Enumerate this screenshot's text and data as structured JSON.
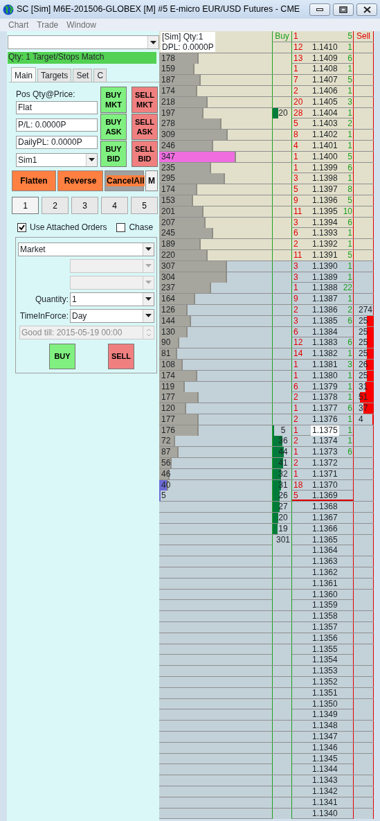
{
  "window": {
    "title": "SC [Sim] M6E-201506-GLOBEX [M]  #5  E-micro EUR/USD Futures - CME"
  },
  "menu": [
    {
      "label": "Chart"
    },
    {
      "label": "Trade"
    },
    {
      "label": "Window"
    }
  ],
  "status": "Qty: 1 Target/Stops Match",
  "tabs": [
    {
      "label": "Main",
      "selected": true
    },
    {
      "label": "Targets",
      "selected": false
    },
    {
      "label": "Set",
      "selected": false
    },
    {
      "label": "C",
      "selected": false
    }
  ],
  "position": {
    "label": "Pos Qty@Price:",
    "fields": [
      "Flat",
      "P/L: 0.0000P",
      "DailyPL: 0.0000P"
    ],
    "account": "Sim1"
  },
  "quick_buttons": [
    {
      "label": "BUY\nMKT",
      "kind": "buy"
    },
    {
      "label": "SELL\nMKT",
      "kind": "sell"
    },
    {
      "label": "BUY\nASK",
      "kind": "buy"
    },
    {
      "label": "SELL\nASK",
      "kind": "sell"
    },
    {
      "label": "BUY\nBID",
      "kind": "buy"
    },
    {
      "label": "SELL\nBID",
      "kind": "sell"
    }
  ],
  "action_buttons": [
    {
      "label": "Flatten",
      "kind": "orange"
    },
    {
      "label": "Reverse",
      "kind": "orange"
    },
    {
      "label": "CancelAll",
      "kind": "cancel"
    },
    {
      "label": "M",
      "kind": "plain"
    }
  ],
  "qty_presets": [
    {
      "label": "1",
      "selected": true
    },
    {
      "label": "2",
      "selected": false
    },
    {
      "label": "3",
      "selected": false
    },
    {
      "label": "4",
      "selected": false
    },
    {
      "label": "5",
      "selected": false
    }
  ],
  "options": [
    {
      "label": "Use Attached Orders",
      "checked": true
    },
    {
      "label": "Chase",
      "checked": false
    }
  ],
  "order_entry": {
    "order_type": "Market",
    "quantity_label": "Quantity:",
    "quantity": "1",
    "tif_label": "TimeInForce:",
    "tif": "Day",
    "good_till": "Good till: 2015-05-19 00:00",
    "buy": "BUY",
    "sell": "SELL"
  },
  "dom": {
    "header": {
      "account": "[Sim]  Qty:1",
      "dpl": "DPL: 0.0000P",
      "buy_title": "Buy",
      "sell_title": "Sell"
    },
    "rows": [
      {
        "column_3": "1",
        "column_5": "5",
        "kind": "upper",
        "last": false
      },
      {
        "price": "1.1410",
        "column_3": "12",
        "column_5": "1",
        "kind": "upper",
        "last": false
      },
      {
        "price": "1.1409",
        "volume": "178",
        "volume_bar": {
          "level": 0.35,
          "color": "#a7a69e"
        },
        "column_3": "13",
        "column_5": "6",
        "kind": "upper",
        "last": false
      },
      {
        "price": "1.1408",
        "volume": "159",
        "volume_bar": {
          "level": 0.31,
          "color": "#a7a69e"
        },
        "column_3": "1",
        "column_5": "1",
        "kind": "upper",
        "last": false
      },
      {
        "price": "1.1407",
        "volume": "187",
        "volume_bar": {
          "level": 0.37,
          "color": "#a7a69e"
        },
        "column_3": "7",
        "column_5": "5",
        "kind": "upper",
        "last": false
      },
      {
        "price": "1.1406",
        "volume": "174",
        "volume_bar": {
          "level": 0.34,
          "color": "#a7a69e"
        },
        "column_3": "2",
        "column_5": "1",
        "kind": "upper",
        "last": false
      },
      {
        "price": "1.1405",
        "volume": "218",
        "volume_bar": {
          "level": 0.43,
          "color": "#a7a69e"
        },
        "column_3": "20",
        "column_5": "3",
        "kind": "upper",
        "last": false
      },
      {
        "price": "1.1404",
        "volume": "197",
        "volume_bar": {
          "level": 0.39,
          "color": "#a7a69e"
        },
        "buy": "20",
        "buy_bar": {
          "level": 0.28
        },
        "column_3": "28",
        "column_5": "1",
        "kind": "upper",
        "last": false
      },
      {
        "price": "1.1403",
        "volume": "278",
        "volume_bar": {
          "level": 0.55,
          "color": "#a7a69e"
        },
        "column_3": "5",
        "column_5": "2",
        "kind": "upper",
        "last": false
      },
      {
        "price": "1.1402",
        "volume": "309",
        "volume_bar": {
          "level": 0.61,
          "color": "#a7a69e"
        },
        "column_3": "8",
        "column_5": "1",
        "kind": "upper",
        "last": false
      },
      {
        "price": "1.1401",
        "volume": "246",
        "volume_bar": {
          "level": 0.48,
          "color": "#a7a69e"
        },
        "column_3": "4",
        "column_5": "1",
        "kind": "upper",
        "last": false
      },
      {
        "price": "1.1400",
        "volume": "347",
        "volume_bar": {
          "level": 0.68,
          "color": "#ee6ee0"
        },
        "column_3": "1",
        "column_5": "5",
        "kind": "upper",
        "last": false
      },
      {
        "price": "1.1399",
        "volume": "235",
        "volume_bar": {
          "level": 0.46,
          "color": "#a7a69e"
        },
        "column_3": "1",
        "column_5": "6",
        "kind": "upper",
        "last": false
      },
      {
        "price": "1.1398",
        "volume": "295",
        "volume_bar": {
          "level": 0.58,
          "color": "#a7a69e"
        },
        "column_3": "3",
        "column_5": "1",
        "kind": "upper",
        "last": false
      },
      {
        "price": "1.1397",
        "volume": "174",
        "volume_bar": {
          "level": 0.34,
          "color": "#a7a69e"
        },
        "column_3": "5",
        "column_5": "8",
        "kind": "upper",
        "last": false
      },
      {
        "price": "1.1396",
        "volume": "153",
        "volume_bar": {
          "level": 0.3,
          "color": "#a7a69e"
        },
        "column_3": "9",
        "column_5": "5",
        "kind": "upper",
        "last": false
      },
      {
        "price": "1.1395",
        "volume": "201",
        "volume_bar": {
          "level": 0.39,
          "color": "#a7a69e"
        },
        "column_3": "11",
        "column_5": "10",
        "kind": "upper",
        "last": false
      },
      {
        "price": "1.1394",
        "volume": "207",
        "volume_bar": {
          "level": 0.41,
          "color": "#a7a69e"
        },
        "column_3": "3",
        "column_5": "6",
        "kind": "upper",
        "last": false
      },
      {
        "price": "1.1393",
        "volume": "245",
        "volume_bar": {
          "level": 0.48,
          "color": "#a7a69e"
        },
        "column_3": "6",
        "column_5": "1",
        "kind": "upper",
        "last": false
      },
      {
        "price": "1.1392",
        "volume": "189",
        "volume_bar": {
          "level": 0.37,
          "color": "#a7a69e"
        },
        "column_3": "2",
        "column_5": "1",
        "kind": "upper",
        "last": false
      },
      {
        "price": "1.1391",
        "volume": "220",
        "volume_bar": {
          "level": 0.43,
          "color": "#a7a69e"
        },
        "column_3": "11",
        "column_5": "5",
        "kind": "upper",
        "last": false
      },
      {
        "price": "1.1390",
        "volume": "307",
        "volume_bar": {
          "level": 0.6,
          "color": "#a7a69e"
        },
        "column_3": "3",
        "column_5": "1",
        "kind": "lower",
        "last": false
      },
      {
        "price": "1.1389",
        "volume": "304",
        "volume_bar": {
          "level": 0.6,
          "color": "#a7a69e"
        },
        "column_3": "3",
        "column_5": "1",
        "kind": "lower",
        "last": false
      },
      {
        "price": "1.1388",
        "volume": "237",
        "volume_bar": {
          "level": 0.46,
          "color": "#a7a69e"
        },
        "column_3": "1",
        "column_5": "22",
        "kind": "lower",
        "last": false
      },
      {
        "price": "1.1387",
        "volume": "164",
        "volume_bar": {
          "level": 0.32,
          "color": "#a7a69e"
        },
        "column_3": "9",
        "column_5": "1",
        "kind": "lower",
        "last": false
      },
      {
        "price": "1.1386",
        "volume": "126",
        "volume_bar": {
          "level": 0.25,
          "color": "#a7a69e"
        },
        "column_3": "2",
        "column_5": "2",
        "sell": "274",
        "kind": "lower",
        "last": false
      },
      {
        "price": "1.1385",
        "volume": "144",
        "volume_bar": {
          "level": 0.28,
          "color": "#a7a69e"
        },
        "column_3": "3",
        "column_5": "6",
        "sell": "25",
        "sell_bar": {
          "level": 0.33
        },
        "kind": "lower",
        "last": false
      },
      {
        "price": "1.1384",
        "volume": "130",
        "volume_bar": {
          "level": 0.25,
          "color": "#a7a69e"
        },
        "column_3": "6",
        "sell": "25",
        "sell_bar": {
          "level": 0.33
        },
        "kind": "lower",
        "last": false
      },
      {
        "price": "1.1383",
        "volume": "90",
        "volume_bar": {
          "level": 0.18,
          "color": "#a7a69e"
        },
        "column_3": "12",
        "column_5": "6",
        "sell": "25",
        "sell_bar": {
          "level": 0.33
        },
        "kind": "lower",
        "last": false
      },
      {
        "price": "1.1382",
        "volume": "81",
        "volume_bar": {
          "level": 0.16,
          "color": "#a7a69e"
        },
        "column_3": "14",
        "column_5": "1",
        "sell": "25",
        "sell_bar": {
          "level": 0.33
        },
        "kind": "lower",
        "last": false
      },
      {
        "price": "1.1381",
        "volume": "108",
        "volume_bar": {
          "level": 0.21,
          "color": "#a7a69e"
        },
        "column_3": "1",
        "column_5": "3",
        "sell": "26",
        "sell_bar": {
          "level": 0.37
        },
        "kind": "lower",
        "last": false
      },
      {
        "price": "1.1380",
        "volume": "174",
        "volume_bar": {
          "level": 0.34,
          "color": "#a7a69e"
        },
        "column_3": "1",
        "column_5": "1",
        "sell": "25",
        "sell_bar": {
          "level": 0.33
        },
        "kind": "lower",
        "last": false
      },
      {
        "price": "1.1379",
        "volume": "119",
        "volume_bar": {
          "level": 0.23,
          "color": "#a7a69e"
        },
        "column_3": "6",
        "column_5": "1",
        "sell": "31",
        "sell_bar": {
          "level": 0.4
        },
        "kind": "lower",
        "last": false
      },
      {
        "price": "1.1378",
        "volume": "177",
        "volume_bar": {
          "level": 0.35,
          "color": "#a7a69e"
        },
        "column_3": "2",
        "column_5": "1",
        "sell": "51",
        "sell_bar": {
          "level": 0.67
        },
        "kind": "lower",
        "last": false
      },
      {
        "price": "1.1377",
        "volume": "120",
        "volume_bar": {
          "level": 0.24,
          "color": "#a7a69e"
        },
        "column_3": "1",
        "column_5": "6",
        "sell": "37",
        "sell_bar": {
          "level": 0.5
        },
        "kind": "lower",
        "last": false
      },
      {
        "price": "1.1376",
        "volume": "177",
        "volume_bar": {
          "level": 0.35,
          "color": "#a7a69e"
        },
        "column_3": "2",
        "column_5": "1",
        "sell": "4",
        "sell_bar": {
          "level": 0.05
        },
        "kind": "lower",
        "last": false
      },
      {
        "price": "1.1375",
        "volume": "176",
        "volume_bar": {
          "level": 0.35,
          "color": "#a7a69e"
        },
        "buy": "5",
        "buy_bar": {
          "level": 0.07
        },
        "column_3": "1",
        "column_5": "1",
        "kind": "lower",
        "last": true
      },
      {
        "price": "1.1374",
        "volume": "72",
        "volume_bar": {
          "level": 0.14,
          "color": "#a7a69e"
        },
        "buy": "36",
        "buy_bar": {
          "level": 0.5
        },
        "column_3": "2",
        "column_5": "1",
        "kind": "lower",
        "last": false
      },
      {
        "price": "1.1373",
        "volume": "87",
        "volume_bar": {
          "level": 0.17,
          "color": "#a7a69e"
        },
        "buy": "44",
        "buy_bar": {
          "level": 0.61
        },
        "column_3": "1",
        "column_5": "6",
        "kind": "lower",
        "last": false
      },
      {
        "price": "1.1372",
        "volume": "56",
        "volume_bar": {
          "level": 0.11,
          "color": "#a7a69e"
        },
        "buy": "41",
        "buy_bar": {
          "level": 0.57
        },
        "column_3": "2",
        "kind": "lower",
        "last": false
      },
      {
        "price": "1.1371",
        "volume": "46",
        "volume_bar": {
          "level": 0.09,
          "color": "#a7a69e"
        },
        "buy": "32",
        "buy_bar": {
          "level": 0.44
        },
        "column_3": "1",
        "kind": "lower",
        "last": false
      },
      {
        "price": "1.1370",
        "volume": "40",
        "volume_bar": {
          "level": 0.08,
          "color": "#6b6bd6"
        },
        "buy": "31",
        "buy_bar": {
          "level": 0.43
        },
        "column_3": "18",
        "kind": "lower",
        "last": false
      },
      {
        "price": "1.1369",
        "volume": "5",
        "volume_bar": {
          "level": 0.01,
          "color": "#6b6bd6"
        },
        "buy": "26",
        "buy_bar": {
          "level": 0.36
        },
        "column_3": "5",
        "kind": "lower",
        "last": false,
        "rule_below": true
      },
      {
        "price": "1.1368",
        "buy": "27",
        "buy_bar": {
          "level": 0.37
        },
        "kind": "lower",
        "last": false
      },
      {
        "price": "1.1367",
        "buy": "20",
        "buy_bar": {
          "level": 0.28
        },
        "kind": "lower",
        "last": false
      },
      {
        "price": "1.1366",
        "buy": "19",
        "buy_bar": {
          "level": 0.26
        },
        "kind": "lower",
        "last": false
      },
      {
        "price": "1.1365",
        "buy": "301",
        "kind": "lower",
        "last": false
      },
      {
        "price": "1.1364",
        "kind": "lower",
        "last": false
      },
      {
        "price": "1.1363",
        "kind": "lower",
        "last": false
      },
      {
        "price": "1.1362",
        "kind": "lower",
        "last": false
      },
      {
        "price": "1.1361",
        "kind": "lower",
        "last": false
      },
      {
        "price": "1.1360",
        "kind": "lower",
        "last": false
      },
      {
        "price": "1.1359",
        "kind": "lower",
        "last": false
      },
      {
        "price": "1.1358",
        "kind": "lower",
        "last": false
      },
      {
        "price": "1.1357",
        "kind": "lower",
        "last": false
      },
      {
        "price": "1.1356",
        "kind": "lower",
        "last": false
      },
      {
        "price": "1.1355",
        "kind": "lower",
        "last": false
      },
      {
        "price": "1.1354",
        "kind": "lower",
        "last": false
      },
      {
        "price": "1.1353",
        "kind": "lower",
        "last": false
      },
      {
        "price": "1.1352",
        "kind": "lower",
        "last": false
      },
      {
        "price": "1.1351",
        "kind": "lower",
        "last": false
      },
      {
        "price": "1.1350",
        "kind": "lower",
        "last": false
      },
      {
        "price": "1.1349",
        "kind": "lower",
        "last": false
      },
      {
        "price": "1.1348",
        "kind": "lower",
        "last": false
      },
      {
        "price": "1.1347",
        "kind": "lower",
        "last": false
      },
      {
        "price": "1.1346",
        "kind": "lower",
        "last": false
      },
      {
        "price": "1.1345",
        "kind": "lower",
        "last": false
      },
      {
        "price": "1.1344",
        "kind": "lower",
        "last": false
      },
      {
        "price": "1.1343",
        "kind": "lower",
        "last": false
      },
      {
        "price": "1.1342",
        "kind": "lower",
        "last": false
      },
      {
        "price": "1.1341",
        "kind": "lower",
        "last": false
      },
      {
        "price": "1.1340",
        "kind": "lower",
        "last": false
      }
    ]
  }
}
